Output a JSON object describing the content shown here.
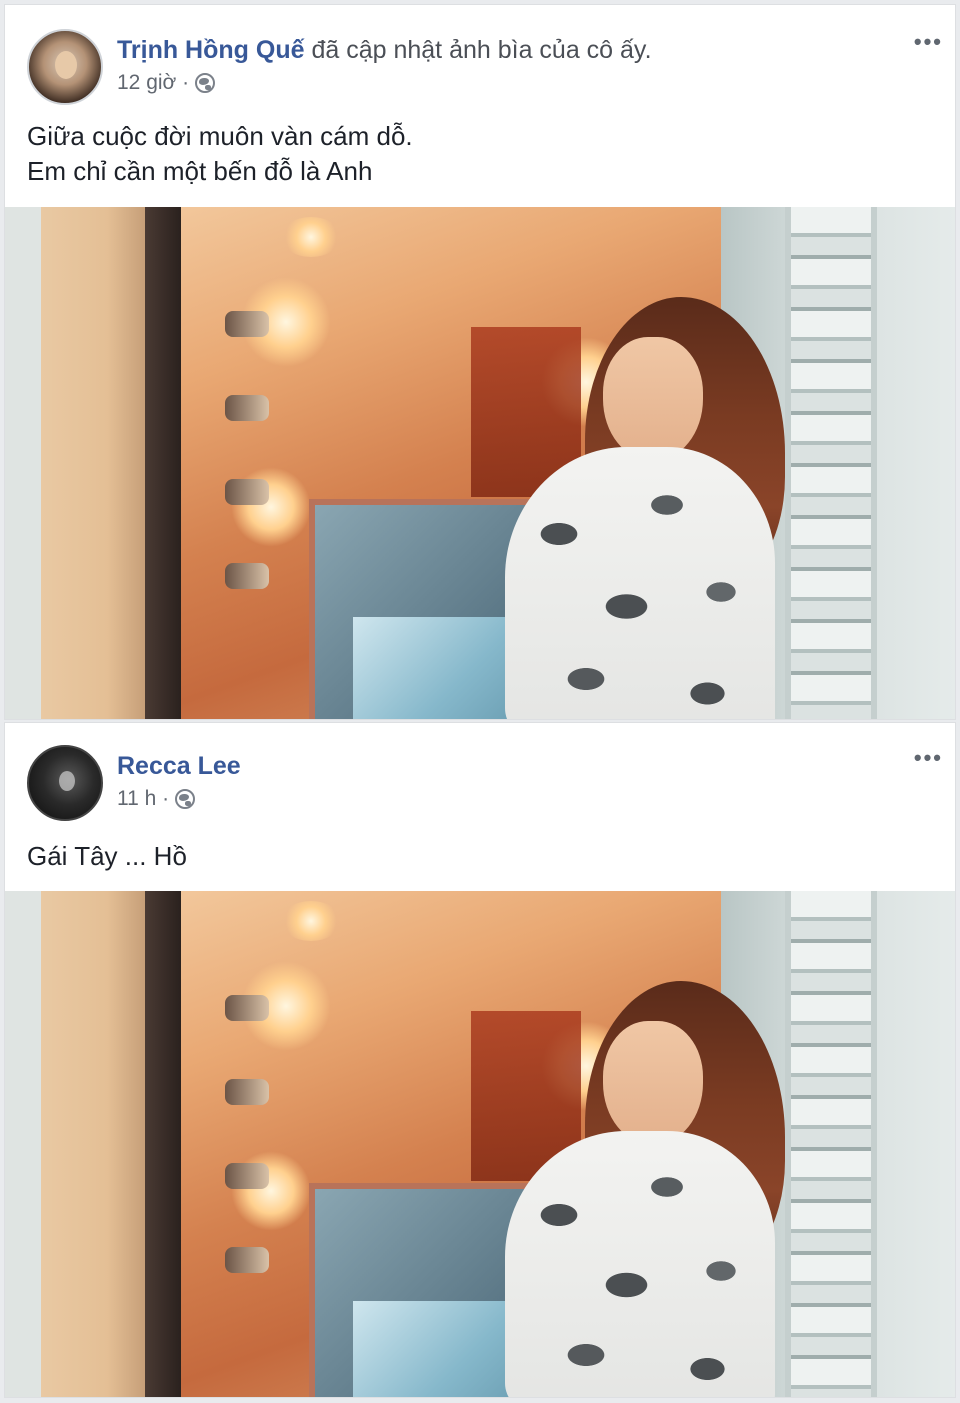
{
  "posts": [
    {
      "author": "Trịnh Hồng Quế",
      "action": "đã cập nhật ảnh bìa của cô ấy.",
      "time": "12 giờ ·",
      "text_lines": [
        "Giữa cuộc đời muôn vàn cám dỗ.",
        "Em chỉ cần một bến đỗ là Anh"
      ],
      "more_label": "•••",
      "privacy_icon": "globe-icon"
    },
    {
      "author": "Recca Lee",
      "action": "",
      "time": "11 h ·",
      "text_lines": [
        "Gái Tây ... Hồ"
      ],
      "more_label": "•••",
      "privacy_icon": "globe-icon"
    }
  ],
  "colors": {
    "name_link": "#385898",
    "meta_text": "#616770",
    "background": "#e9ebee"
  }
}
